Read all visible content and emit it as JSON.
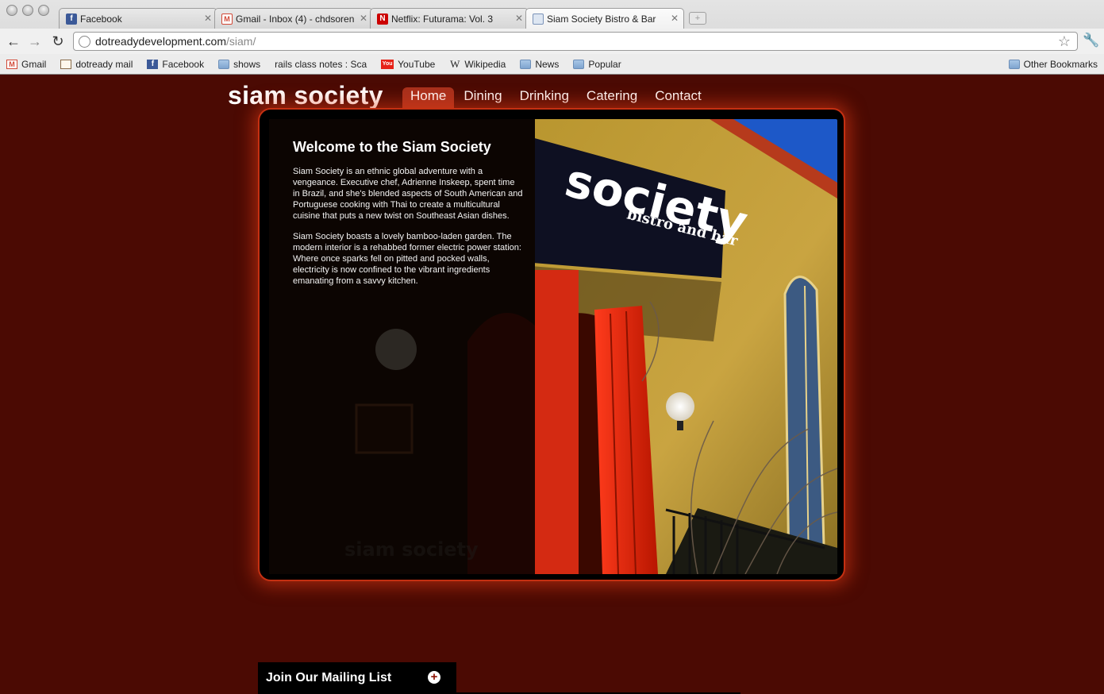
{
  "browser": {
    "tabs": [
      {
        "title": "Facebook",
        "favicon": "facebook-icon",
        "active": false
      },
      {
        "title": "Gmail - Inbox (4) - chdsoren",
        "favicon": "gmail-icon",
        "active": false
      },
      {
        "title": "Netflix: Futurama: Vol. 3",
        "favicon": "netflix-icon",
        "active": false
      },
      {
        "title": "Siam Society Bistro & Bar",
        "favicon": "page-icon",
        "active": true
      }
    ],
    "url_host": "dotreadydevelopment.com",
    "url_path": "/siam/",
    "bookmarks": [
      {
        "label": "Gmail",
        "icon": "gmail-icon"
      },
      {
        "label": "dotready mail",
        "icon": "mail-icon"
      },
      {
        "label": "Facebook",
        "icon": "facebook-icon"
      },
      {
        "label": "shows",
        "icon": "folder-icon"
      },
      {
        "label": "rails class notes : Sca",
        "icon": "page-icon"
      },
      {
        "label": "YouTube",
        "icon": "youtube-icon"
      },
      {
        "label": "Wikipedia",
        "icon": "wikipedia-icon"
      },
      {
        "label": "News",
        "icon": "folder-icon"
      },
      {
        "label": "Popular",
        "icon": "folder-icon"
      }
    ],
    "other_bookmarks": "Other Bookmarks"
  },
  "site": {
    "logo": "siam society",
    "nav": [
      {
        "label": "Home",
        "active": true
      },
      {
        "label": "Dining",
        "active": false
      },
      {
        "label": "Drinking",
        "active": false
      },
      {
        "label": "Catering",
        "active": false
      },
      {
        "label": "Contact",
        "active": false
      }
    ],
    "welcome_title": "Welcome to the Siam Society",
    "paragraphs": [
      "Siam Society is an ethnic global adventure with a vengeance. Executive chef, Adrienne Inskeep, spent time in Brazil, and she's blended aspects of South American and Portuguese cooking with Thai to create a multicultural cuisine that puts a new twist on Southeast Asian dishes.",
      "Siam Society boasts a lovely bamboo-laden garden. The modern interior is a rehabbed former electric power station: Where once sparks fell on pitted and pocked walls, electricity is now confined to the vibrant ingredients emanating from a savvy kitchen."
    ],
    "photo_sign": "society",
    "photo_sign_sub": "bistro and bar",
    "mailing_list": "Join Our Mailing List",
    "colors": {
      "background": "#4b0a03",
      "accent": "#a8301c",
      "glow": "#c43012"
    }
  }
}
